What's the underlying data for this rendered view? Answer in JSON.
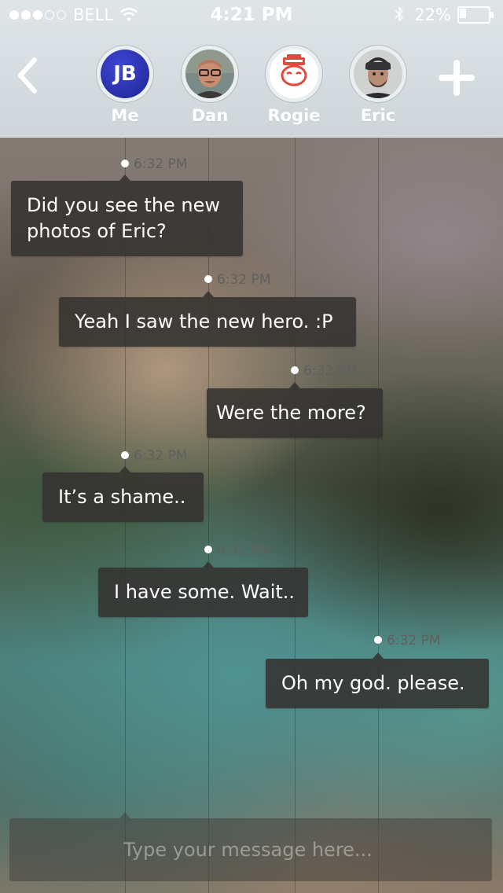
{
  "status_bar": {
    "signal_full": 3,
    "signal_empty": 2,
    "carrier": "BELL",
    "time": "4:21 PM",
    "battery": "22%",
    "battery_level": 0.22,
    "icons": [
      "wifi-icon",
      "bluetooth-icon",
      "battery-icon"
    ]
  },
  "header": {
    "back_icon": "chevron-left-icon",
    "add_icon": "plus-icon",
    "participants": [
      {
        "name": "Me",
        "initials": "JB",
        "avatar_color": "#2a33b8"
      },
      {
        "name": "Dan"
      },
      {
        "name": "Rogie"
      },
      {
        "name": "Eric"
      }
    ]
  },
  "messages": [
    {
      "time": "6:32 PM",
      "text": "Did you see the new photos of Eric?",
      "sender": "Me"
    },
    {
      "time": "6:32 PM",
      "text": "Yeah I saw the new hero. :P",
      "sender": "Dan"
    },
    {
      "time": "6:32 PM",
      "text": "Were the more?",
      "sender": "Rogie"
    },
    {
      "time": "6:32 PM",
      "text": "It’s a shame..",
      "sender": "Me"
    },
    {
      "time": "6:32 PM",
      "text": "I have some. Wait..",
      "sender": "Dan"
    },
    {
      "time": "6:32 PM",
      "text": "Oh my god. please.",
      "sender": "Eric"
    }
  ],
  "composer": {
    "placeholder": "Type your message here..."
  },
  "colors": {
    "header_bg": "#d6dde1",
    "bubble_bg": "#343230",
    "accent_me": "#2a33b8"
  }
}
